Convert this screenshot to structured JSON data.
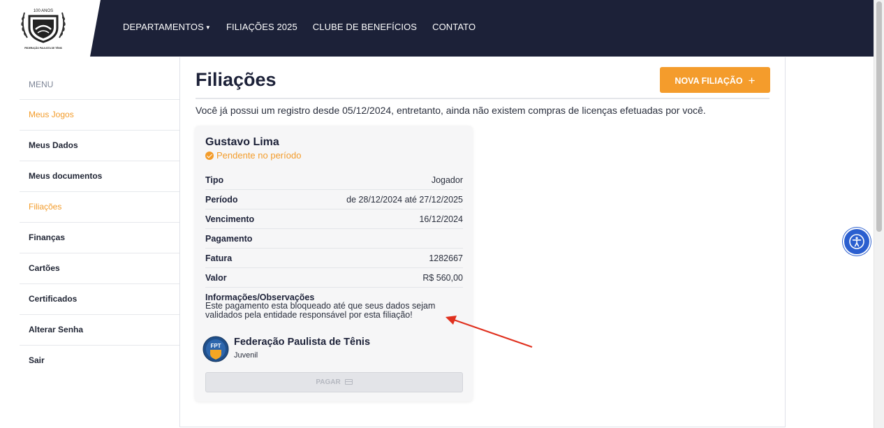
{
  "header": {
    "logo_top_text": "100 ANOS",
    "logo_bottom_text": "FEDERAÇÃO PAULISTA DE TÊNIS",
    "nav": [
      {
        "label": "DEPARTAMENTOS",
        "has_dropdown": true
      },
      {
        "label": "FILIAÇÕES 2025"
      },
      {
        "label": "CLUBE DE BENEFÍCIOS"
      },
      {
        "label": "CONTATO"
      }
    ]
  },
  "sidebar": {
    "title": "MENU",
    "items": [
      {
        "label": "Meus Jogos",
        "accent": true
      },
      {
        "label": "Meus Dados"
      },
      {
        "label": "Meus documentos"
      },
      {
        "label": "Filiações",
        "accent": true
      },
      {
        "label": "Finanças"
      },
      {
        "label": "Cartões"
      },
      {
        "label": "Certificados"
      },
      {
        "label": "Alterar Senha"
      },
      {
        "label": "Sair"
      }
    ]
  },
  "main": {
    "title": "Filiações",
    "new_button": "NOVA FILIAÇÃO",
    "info": "Você já possui um registro desde 05/12/2024, entretanto, ainda não existem compras de licenças efetuadas por você.",
    "card": {
      "name": "Gustavo Lima",
      "status": "Pendente no período",
      "rows": [
        {
          "key": "Tipo",
          "value": "Jogador"
        },
        {
          "key": "Período",
          "value": "de 28/12/2024 até 27/12/2025"
        },
        {
          "key": "Vencimento",
          "value": "16/12/2024"
        },
        {
          "key": "Pagamento",
          "value": ""
        },
        {
          "key": "Fatura",
          "value": "1282667"
        },
        {
          "key": "Valor",
          "value": "R$ 560,00"
        }
      ],
      "obs_title": "Informações/Observações",
      "obs_text": "Este pagamento esta bloqueado até que seus dados sejam validados pela entidade responsável por esta filiação!",
      "org_name": "Federação Paulista de Tênis",
      "org_sub": "Juvenil",
      "org_logo_text": "FPT",
      "pay_button": "PAGAR"
    }
  },
  "colors": {
    "header_bg": "#1c2138",
    "accent": "#f49c2c",
    "annotation_arrow": "#e0301e",
    "a11y_button": "#2b5fcf"
  }
}
